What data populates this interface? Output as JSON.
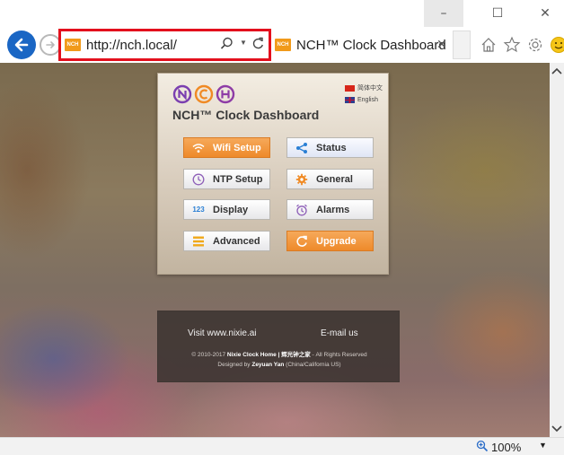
{
  "window": {
    "minimize_glyph": "–",
    "maximize_glyph": "☐",
    "close_glyph": "✕"
  },
  "address_bar": {
    "url": "http://nch.local/",
    "favicon_text": "NCH",
    "highlight_color": "#e3101d"
  },
  "tab": {
    "title": "NCH™ Clock Dashboard",
    "close_glyph": "✕"
  },
  "toolbar_icons": [
    "home-icon",
    "favorites-star-icon",
    "settings-gear-icon",
    "smiley-feedback-icon"
  ],
  "panel": {
    "logo_letters": [
      "N",
      "C",
      "H"
    ],
    "logo_colors": [
      "#7b3fb0",
      "#f08a24",
      "#8e3ca6"
    ],
    "title": "NCH™ Clock Dashboard",
    "languages": [
      {
        "label": "简体中文",
        "flag": "cn"
      },
      {
        "label": "English",
        "flag": "gb"
      }
    ],
    "buttons": [
      {
        "label": "Wifi Setup",
        "icon": "wifi-icon",
        "style": "orange"
      },
      {
        "label": "Status",
        "icon": "share-icon",
        "style": "blue"
      },
      {
        "label": "NTP Setup",
        "icon": "clock-icon",
        "style": "plain"
      },
      {
        "label": "General",
        "icon": "gear-icon",
        "style": "plain"
      },
      {
        "label": "Display",
        "icon": "numbers-icon",
        "style": "plain"
      },
      {
        "label": "Alarms",
        "icon": "alarm-icon",
        "style": "plain"
      },
      {
        "label": "Advanced",
        "icon": "menu-lines-icon",
        "style": "plain"
      },
      {
        "label": "Upgrade",
        "icon": "refresh-icon",
        "style": "orange"
      }
    ]
  },
  "footer": {
    "visit_link": "Visit www.nixie.ai",
    "email_link": "E-mail us",
    "copyright_prefix": "© 2010-2017",
    "copyright_site": "Nixie Clock Home | 辉光钟之家",
    "copyright_suffix": "- All Rights Reserved",
    "designed_prefix": "Designed by",
    "designer": "Zeyuan Yan",
    "designer_location": "(China/California US)"
  },
  "statusbar": {
    "zoom": "100%",
    "zoom_dropdown_glyph": "▼"
  },
  "colors": {
    "accent_orange": "#ee8a2a",
    "ie_blue": "#1a66c4"
  }
}
